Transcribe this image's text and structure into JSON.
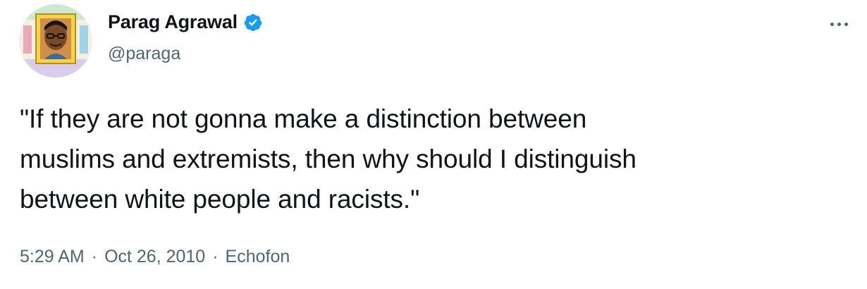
{
  "author": {
    "display_name": "Parag Agrawal",
    "handle": "@paraga",
    "verified": true,
    "verified_icon": "verified-badge-icon",
    "verified_color": "#1d9bf0",
    "avatar": "cartoon-avatar"
  },
  "tweet": {
    "lines": [
      "\"If they are not gonna make a distinction between",
      "muslims and extremists, then why should I distinguish",
      "between white people and racists.\""
    ],
    "time": "5:29 AM",
    "date": "Oct 26, 2010",
    "source": "Echofon",
    "separator": "·"
  },
  "menu": {
    "icon": "more-options-icon"
  }
}
